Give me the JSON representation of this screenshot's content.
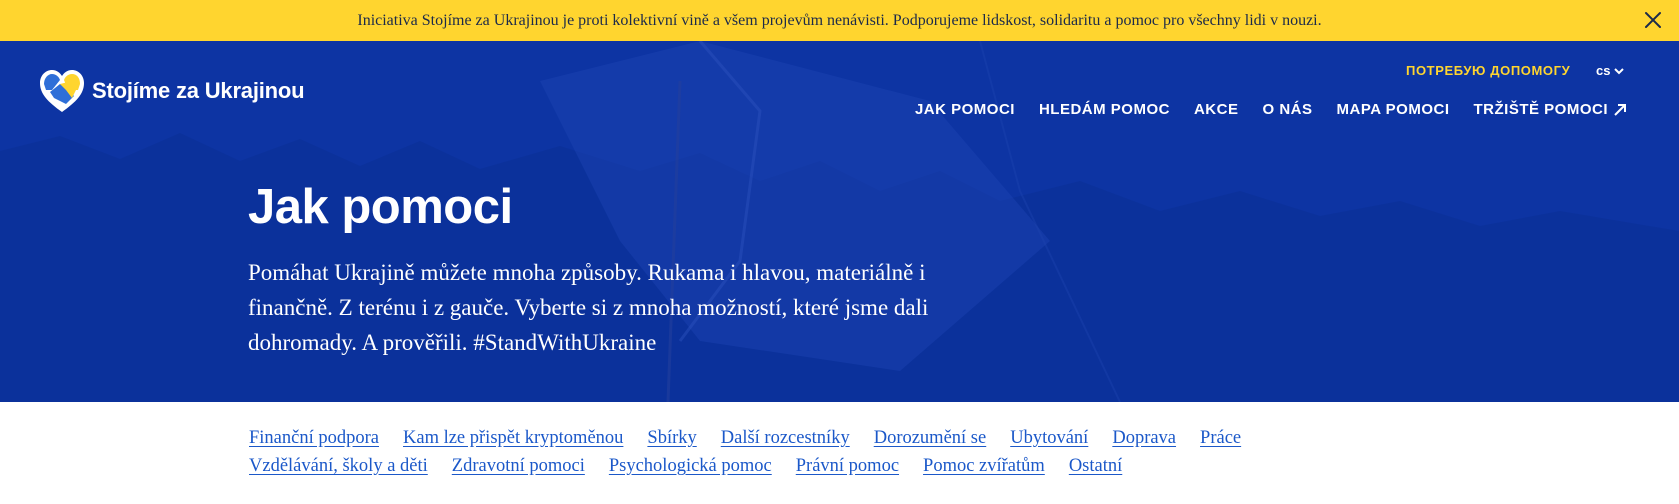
{
  "banner": {
    "text": "Iniciativa Stojíme za Ukrajinou je proti kolektivní vině a všem projevům nenávisti. Podporujeme lidskost, solidaritu a pomoc pro všechny lidi v nouzi.",
    "close_icon": "close-icon"
  },
  "header": {
    "logo_text": "Stojíme za Ukrajinou",
    "logo_icon": "heart-handshake-icon",
    "need_help": "ПОТРЕБУЮ ДОПОМОГУ",
    "language": "cs",
    "nav": [
      {
        "label": "JAK POMOCI"
      },
      {
        "label": "HLEDÁM POMOC"
      },
      {
        "label": "AKCE"
      },
      {
        "label": "O NÁS"
      },
      {
        "label": "MAPA POMOCI"
      },
      {
        "label": "TRŽIŠTĚ POMOCI",
        "icon": "external-arrow-icon"
      }
    ]
  },
  "hero": {
    "title": "Jak pomoci",
    "text": "Pomáhat Ukrajině můžete mnoha způsoby. Rukama i hlavou, materiálně i finančně. Z terénu i z gauče. Vyberte si z mnoha možností, které jsme dali dohromady. A prověřili. #StandWithUkraine"
  },
  "category_links": {
    "row1": [
      "Finanční podpora",
      "Kam lze přispět kryptoměnou",
      "Sbírky",
      "Další rozcestníky",
      "Dorozumění se",
      "Ubytování",
      "Doprava",
      "Práce"
    ],
    "row2": [
      "Vzdělávání, školy a děti",
      "Zdravotní pomoci",
      "Psychologická pomoc",
      "Právní pomoc",
      "Pomoc zvířatům",
      "Ostatní"
    ]
  },
  "colors": {
    "banner_bg": "#ffd52f",
    "hero_bg": "#0d34a3",
    "accent_yellow": "#ffd52f",
    "link": "#1b58c9"
  }
}
